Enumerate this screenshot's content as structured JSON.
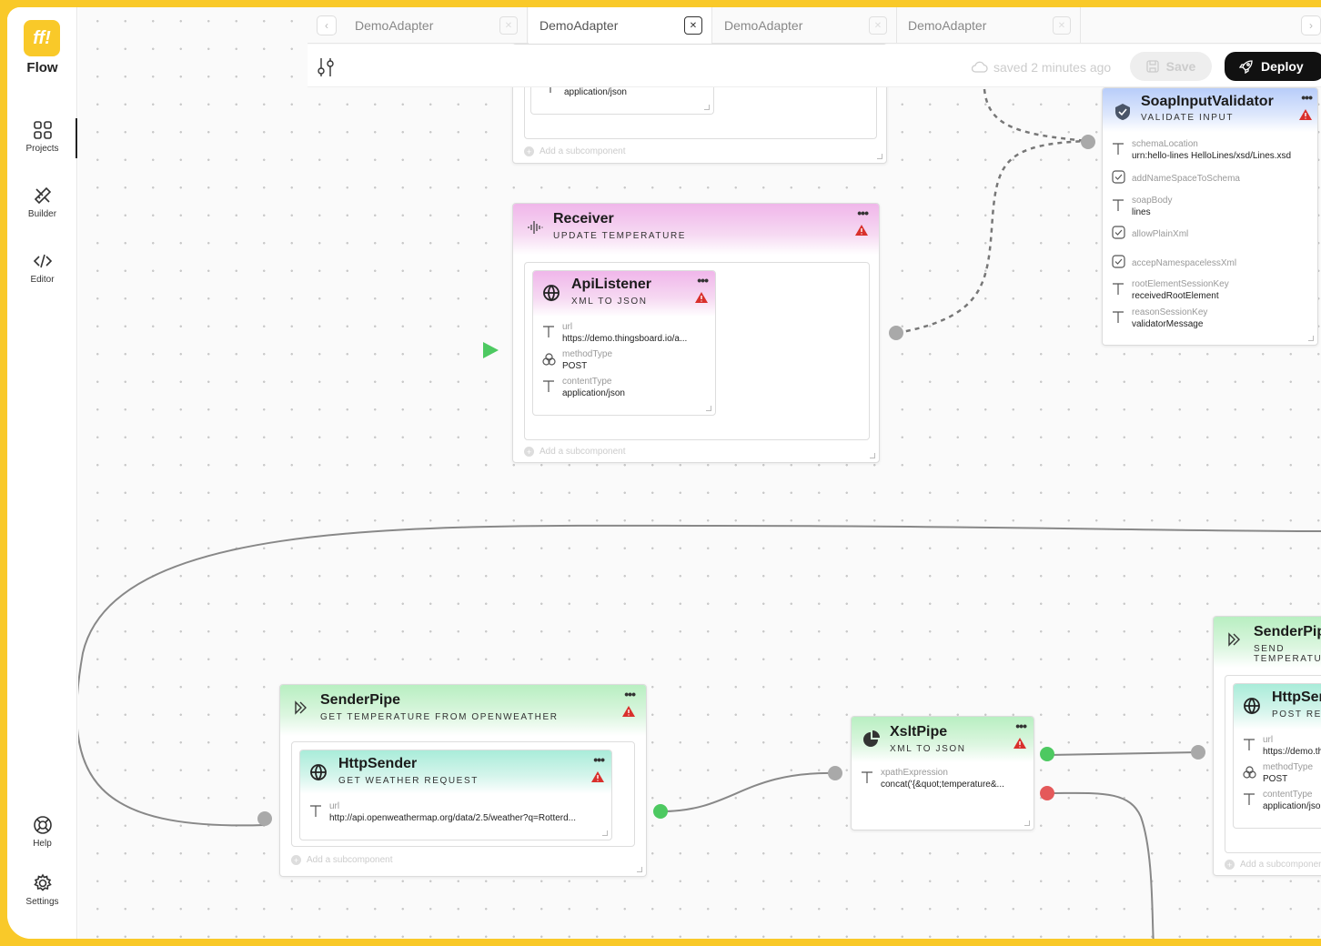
{
  "app": {
    "logo": "ff!",
    "name": "Flow"
  },
  "sidebar": {
    "items": [
      {
        "label": "Projects",
        "icon": "grid-icon"
      },
      {
        "label": "Builder",
        "icon": "pencil-ruler-icon"
      },
      {
        "label": "Editor",
        "icon": "code-icon"
      }
    ],
    "bottom": [
      {
        "label": "Help",
        "icon": "lifebuoy-icon"
      },
      {
        "label": "Settings",
        "icon": "gear-icon"
      }
    ]
  },
  "tabs": [
    {
      "label": "DemoAdapter",
      "active": false
    },
    {
      "label": "DemoAdapter",
      "active": true
    },
    {
      "label": "DemoAdapter",
      "active": false
    },
    {
      "label": "DemoAdapter",
      "active": false
    }
  ],
  "toolbar": {
    "saved_text": "saved 2 minutes ago",
    "save_label": "Save",
    "deploy_label": "Deploy"
  },
  "nodes": {
    "top_partial": {
      "value": "application/json",
      "add_label": "Add a subcomponent"
    },
    "receiver": {
      "title": "Receiver",
      "subtitle": "UPDATE TEMPERATURE",
      "add_label": "Add a subcomponent",
      "child": {
        "title": "ApiListener",
        "subtitle": "XML TO JSON",
        "props": [
          {
            "key": "url",
            "value": "https://demo.thingsboard.io/a..."
          },
          {
            "key": "methodType",
            "value": "POST"
          },
          {
            "key": "contentType",
            "value": "application/json"
          }
        ]
      }
    },
    "soap": {
      "title": "SoapInputValidator",
      "subtitle": "VALIDATE INPUT",
      "props": [
        {
          "key": "schemaLocation",
          "value": "urn:hello-lines HelloLines/xsd/Lines.xsd",
          "type": "text"
        },
        {
          "key": "addNameSpaceToSchema",
          "value": "",
          "type": "check"
        },
        {
          "key": "soapBody",
          "value": "lines",
          "type": "text"
        },
        {
          "key": "allowPlainXml",
          "value": "",
          "type": "check"
        },
        {
          "key": "accepNamespacelessXml",
          "value": "",
          "type": "check"
        },
        {
          "key": "rootElementSessionKey",
          "value": "receivedRootElement",
          "type": "text"
        },
        {
          "key": "reasonSessionKey",
          "value": "validatorMessage",
          "type": "text"
        }
      ]
    },
    "sender_weather": {
      "title": "SenderPipe",
      "subtitle": "GET TEMPERATURE FROM OPENWEATHER",
      "add_label": "Add a subcomponent",
      "child": {
        "title": "HttpSender",
        "subtitle": "GET WEATHER REQUEST",
        "props": [
          {
            "key": "url",
            "value": "http://api.openweathermap.org/data/2.5/weather?q=Rotterd..."
          }
        ]
      }
    },
    "xslt": {
      "title": "XsltPipe",
      "subtitle": "XML TO JSON",
      "props": [
        {
          "key": "xpathExpression",
          "value": "concat('{&quot;temperature&..."
        }
      ]
    },
    "sender_right": {
      "title": "SenderPipe",
      "subtitle": "SEND TEMPERATURE",
      "add_label": "Add a subcomponent",
      "child": {
        "title": "HttpSender",
        "subtitle": "POST REQUEST",
        "props": [
          {
            "key": "url",
            "value": "https://demo.thingsboard.io"
          },
          {
            "key": "methodType",
            "value": "POST"
          },
          {
            "key": "contentType",
            "value": "application/json"
          }
        ]
      }
    }
  },
  "colors": {
    "accent": "#f9c929",
    "warning": "#d9302c",
    "deploy": "#111111"
  }
}
